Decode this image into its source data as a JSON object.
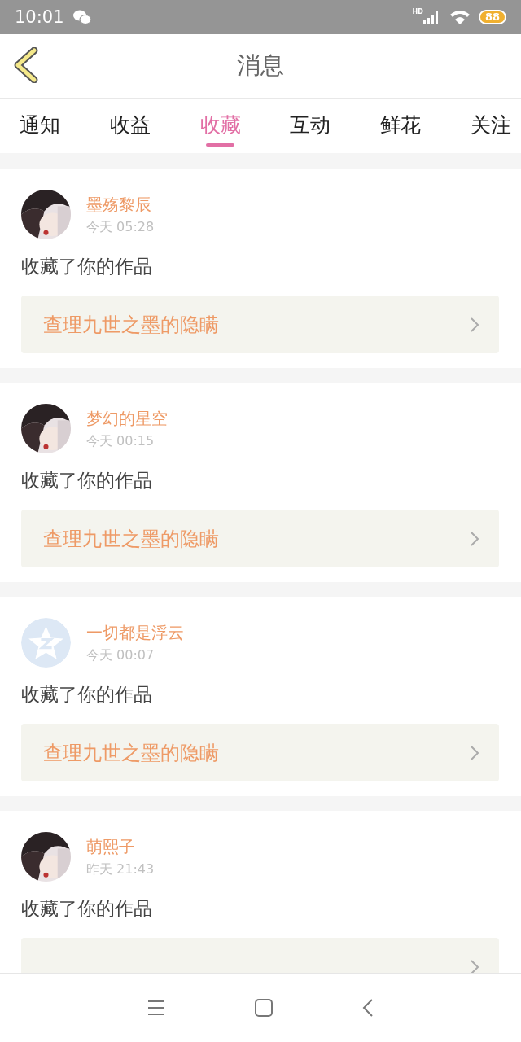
{
  "status_bar": {
    "time": "10:01",
    "network": "HD",
    "battery": "88"
  },
  "header": {
    "title": "消息"
  },
  "tabs": [
    {
      "label": "通知",
      "selected": false
    },
    {
      "label": "收益",
      "selected": false
    },
    {
      "label": "收藏",
      "selected": true
    },
    {
      "label": "互动",
      "selected": false
    },
    {
      "label": "鲜花",
      "selected": false
    },
    {
      "label": "关注",
      "selected": false
    }
  ],
  "messages": [
    {
      "user": "墨殇黎辰",
      "time": "今天 05:28",
      "action": "收藏了你的作品",
      "work": "查理九世之墨的隐瞒"
    },
    {
      "user": "梦幻的星空",
      "time": "今天 00:15",
      "action": "收藏了你的作品",
      "work": "查理九世之墨的隐瞒"
    },
    {
      "user": "一切都是浮云",
      "time": "今天 00:07",
      "avatar": {
        "kind": "default"
      },
      "action": "收藏了你的作品",
      "work": "查理九世之墨的隐瞒"
    },
    {
      "user": "萌熙子",
      "time": "昨天 21:43",
      "action": "收藏了你的作品"
    }
  ]
}
